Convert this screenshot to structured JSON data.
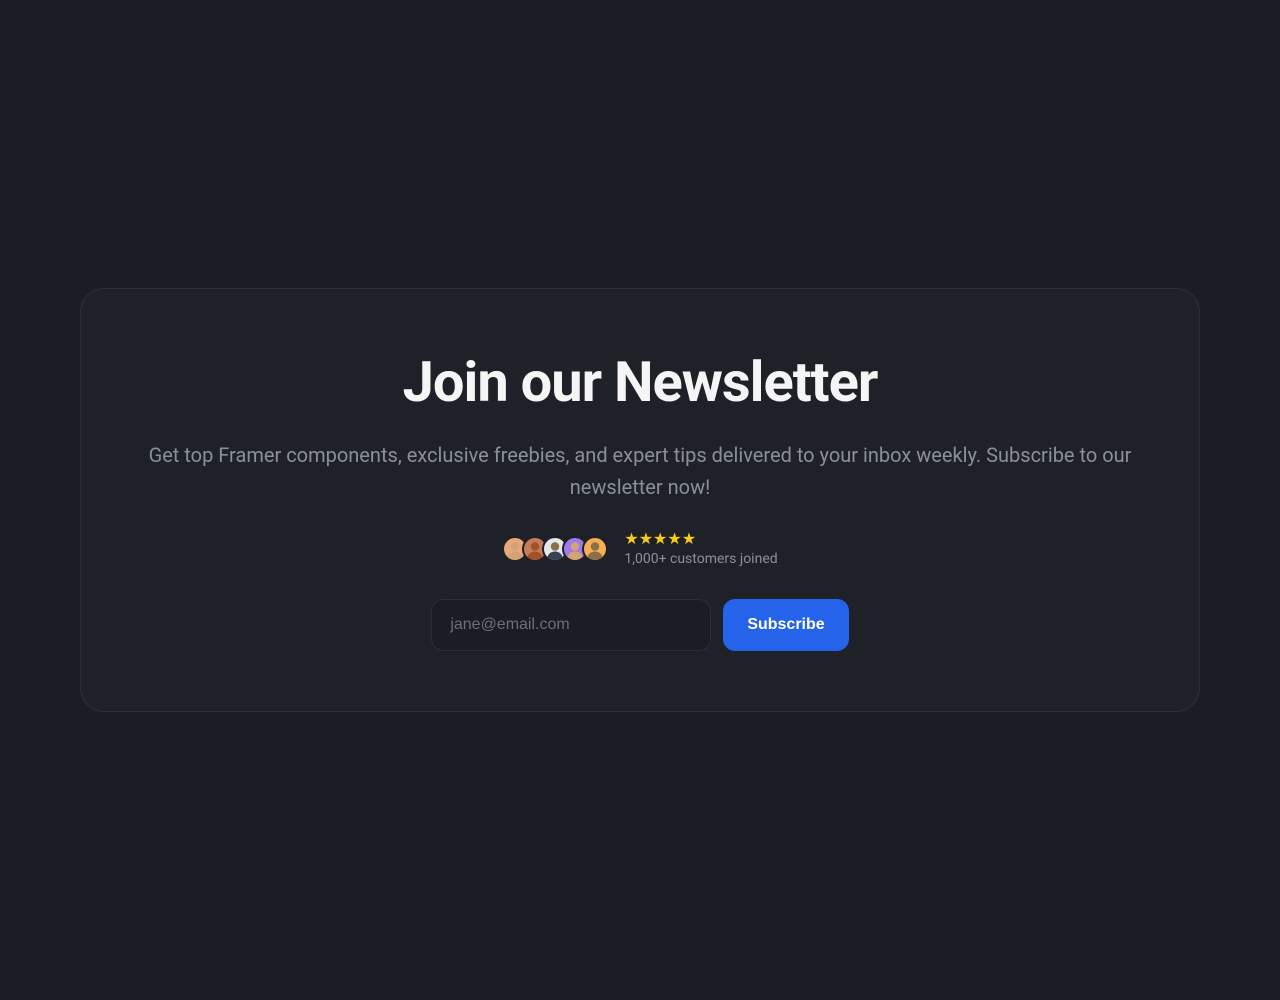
{
  "heading": "Join our Newsletter",
  "description": "Get top Framer components, exclusive freebies, and expert tips delivered to your inbox weekly. Subscribe to our newsletter now!",
  "social_proof": {
    "star_count": 5,
    "customers_text": "1,000+ customers joined"
  },
  "form": {
    "email_placeholder": "jane@email.com",
    "subscribe_label": "Subscribe"
  },
  "avatars": [
    {
      "bg": "#e8a87c",
      "skin": "#d4a373"
    },
    {
      "bg": "#c77b58",
      "skin": "#a0522d"
    },
    {
      "bg": "#6b7280",
      "skin": "#8b6f47"
    },
    {
      "bg": "#9f7aea",
      "skin": "#d4a373"
    },
    {
      "bg": "#f6ad55",
      "skin": "#8b6f47"
    }
  ]
}
